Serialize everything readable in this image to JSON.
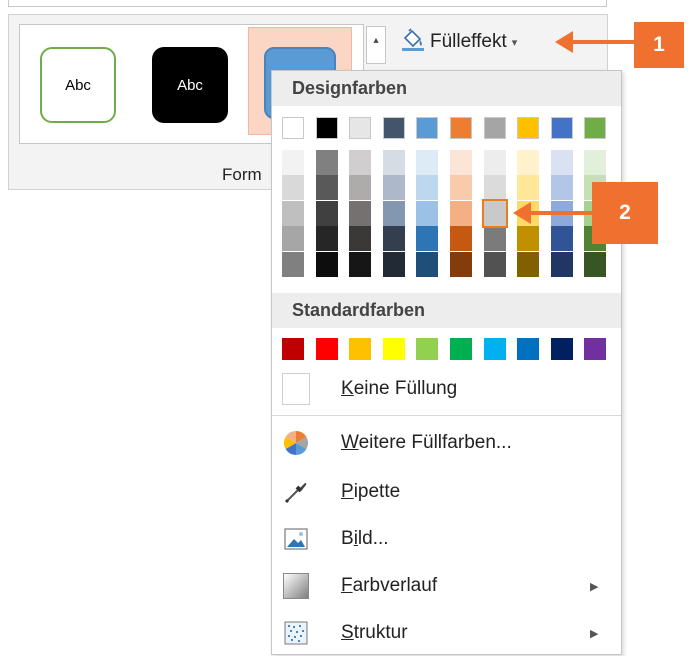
{
  "ribbon": {
    "group_label": "Form",
    "style_thumb_1_label": "Abc",
    "style_thumb_2_label": "Abc",
    "fill_button_label": "Fülleffekt",
    "fill_button_caret": "▾",
    "scroll_up_glyph": "▴"
  },
  "dropdown": {
    "design_colors_header": "Designfarben",
    "standard_colors_header": "Standardfarben",
    "theme_colors": [
      "#ffffff",
      "#000000",
      "#e7e6e6",
      "#44546a",
      "#5b9bd5",
      "#ed7d31",
      "#a5a5a5",
      "#ffc000",
      "#4472c4",
      "#70ad47"
    ],
    "theme_shades": [
      [
        "#f2f2f2",
        "#d9d9d9",
        "#bfbfbf",
        "#a6a6a6",
        "#808080"
      ],
      [
        "#808080",
        "#595959",
        "#404040",
        "#262626",
        "#0d0d0d"
      ],
      [
        "#d0cece",
        "#aeabab",
        "#757171",
        "#3b3838",
        "#171616"
      ],
      [
        "#d6dce4",
        "#adb9ca",
        "#8497b0",
        "#333f4f",
        "#222a35"
      ],
      [
        "#ddebf7",
        "#bdd7ee",
        "#9bc2e6",
        "#2e75b6",
        "#1f4e79"
      ],
      [
        "#fce4d6",
        "#f8cbad",
        "#f4b084",
        "#c65911",
        "#843c0c"
      ],
      [
        "#ededed",
        "#dbdbdb",
        "#c9c9c9",
        "#7b7b7b",
        "#525252"
      ],
      [
        "#fff2cc",
        "#ffe699",
        "#ffd966",
        "#bf8f00",
        "#806000"
      ],
      [
        "#d9e1f2",
        "#b4c6e7",
        "#8ea9db",
        "#305496",
        "#203764"
      ],
      [
        "#e2efda",
        "#c6e0b4",
        "#a9d08e",
        "#548235",
        "#375623"
      ]
    ],
    "standard_colors": [
      "#c00000",
      "#ff0000",
      "#ffc000",
      "#ffff00",
      "#92d050",
      "#00b050",
      "#00b0f0",
      "#0070c0",
      "#002060",
      "#7030a0"
    ],
    "hover_swatch_color": "#c9c9c9",
    "items": {
      "no_fill": {
        "access_key": "K",
        "rest": "eine Füllung"
      },
      "more_colors": {
        "access_key": "W",
        "rest": "eitere Füllfarben..."
      },
      "eyedropper": {
        "access_key": "P",
        "rest": "ipette"
      },
      "picture": {
        "pre": "B",
        "access_key": "i",
        "rest": "ld..."
      },
      "gradient": {
        "access_key": "F",
        "rest": "arbverlauf"
      },
      "texture": {
        "access_key": "S",
        "rest": "truktur"
      }
    },
    "submenu_arrow": "▶"
  },
  "callouts": {
    "first": "1",
    "second": "2"
  },
  "colors": {
    "accent_orange": "#f07030",
    "selected_thumb_bg": "#fbd6c4"
  }
}
